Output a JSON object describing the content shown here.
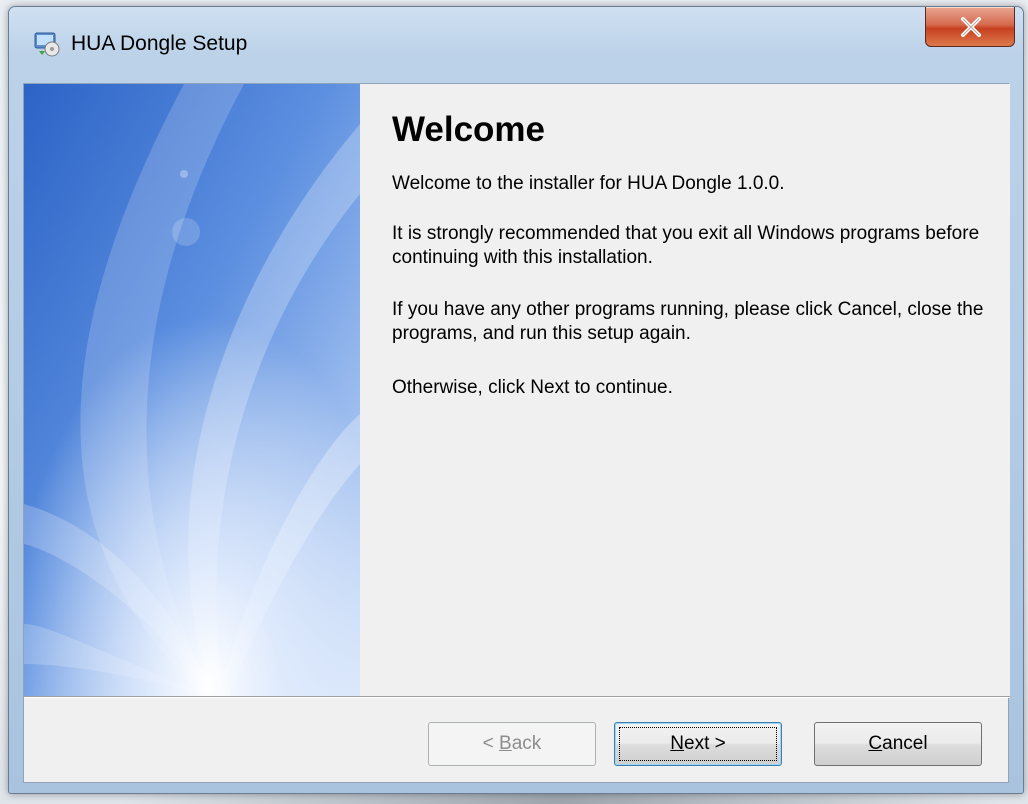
{
  "window": {
    "title": "HUA Dongle Setup",
    "icon": "setup-installer-icon",
    "close_icon": "close-icon"
  },
  "side_panel": {
    "image": "decorative-light-rays"
  },
  "content": {
    "heading": "Welcome",
    "paragraphs": [
      "Welcome to the installer for HUA Dongle 1.0.0.",
      "It is strongly recommended that you exit all Windows programs before continuing with this installation.",
      "If you have any other programs running, please click Cancel, close the programs, and run this setup again.",
      "Otherwise, click Next to continue."
    ]
  },
  "buttons": {
    "back": {
      "pre": "< ",
      "mnemonic": "B",
      "rest": "ack",
      "enabled": false
    },
    "next": {
      "mnemonic": "N",
      "rest": "ext >",
      "enabled": true,
      "default": true
    },
    "cancel": {
      "mnemonic": "C",
      "rest": "ancel",
      "enabled": true
    }
  },
  "colors": {
    "close_button": "#c7401f",
    "side_panel_blue": "#4a7fd6",
    "dialog_background": "#f0f0f0"
  }
}
